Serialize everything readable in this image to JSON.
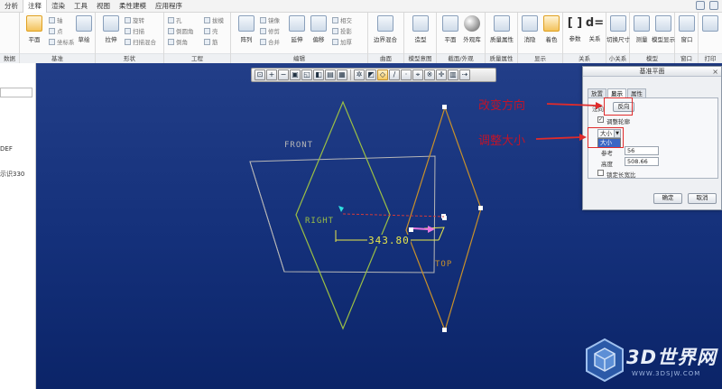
{
  "menubar": {
    "items": [
      "分析",
      "注释",
      "渲染",
      "工具",
      "视图",
      "柔性建模",
      "应用程序"
    ],
    "active_index": 1
  },
  "ribbon": {
    "groups": [
      {
        "label": "数据"
      },
      {
        "label": "基准"
      },
      {
        "label": "形状"
      },
      {
        "label": "工程"
      },
      {
        "label": "编辑"
      },
      {
        "label": "曲面"
      },
      {
        "label": "模型意图"
      },
      {
        "label": "截面/外观"
      },
      {
        "label": "质量属性"
      },
      {
        "label": "显示"
      },
      {
        "label": "关系"
      },
      {
        "label": "小关系"
      },
      {
        "label": "模型"
      },
      {
        "label": "窗口"
      },
      {
        "label": "打印"
      }
    ],
    "buttons": {
      "plane": "平面",
      "axis": "轴",
      "point": "点",
      "csys": "坐标系",
      "sketch": "草绘",
      "extrude": "拉伸",
      "revolve": "旋转",
      "sweep": "扫描",
      "swept_blend": "扫描混合",
      "hole": "孔",
      "round": "倒圆角",
      "chamfer": "倒角",
      "shell": "壳",
      "draft": "拔模",
      "rib": "筋",
      "pattern": "阵列",
      "mirror": "镜像",
      "trim": "修剪",
      "merge": "合并",
      "extend": "延伸",
      "offset": "偏移",
      "intersect": "相交",
      "project": "投影",
      "thicken": "加厚",
      "solidify": "实体化",
      "boundary_blend": "边界混合",
      "style": "造型",
      "freestyle": "自由式",
      "plane_view": "平面",
      "appearance": "外观库",
      "mass_props": "质量属性",
      "hidden": "消隐",
      "shaded": "着色",
      "params": "参数",
      "relations": "关系",
      "switch_size": "切换尺寸",
      "measure": "测量",
      "model_tree": "模型显示",
      "window": "窗口"
    }
  },
  "tree": {
    "texts": [
      "DEF",
      "示识330"
    ]
  },
  "viewport": {
    "plane_labels": {
      "front": "FRONT",
      "right": "RIGHT",
      "top": "TOP"
    },
    "dimension": "343.80",
    "toolbar_icons": [
      "zoom-fit",
      "zoom-in",
      "zoom-out",
      "refit",
      "repaint",
      "shading",
      "display-style",
      "saved-views",
      "datum-plane-display",
      "axis-display",
      "point-display",
      "csys-display",
      "annotation-display",
      "spin-center"
    ]
  },
  "dialog": {
    "title": "基准平面",
    "tabs": [
      "放置",
      "显示",
      "属性"
    ],
    "active_tab": 1,
    "normal_label": "法向",
    "flip_button": "反向",
    "adjust_outline_label": "调整轮廓",
    "adjust_outline_checked": true,
    "size_select": "大小",
    "size_option": "大小",
    "ref_label": "参考",
    "ref_value": "56",
    "height_label": "高度",
    "height_value": "508.66",
    "lock_ratio_label": "锁定长宽比",
    "lock_ratio_checked": false,
    "ok_label": "确定",
    "cancel_label": "取消"
  },
  "annotations": {
    "flip_direction": "改变方向",
    "adjust_size": "调整大小"
  },
  "watermark": {
    "text": "3D世界网",
    "url": "WWW.3DSJW.COM"
  },
  "colors": {
    "viewport_bg": "#1a3680",
    "annotation": "#c0142a",
    "plane_green": "#8fb23a",
    "plane_orange": "#c8902a",
    "plane_gray": "#b8b8b8",
    "dimension_yellow": "#e9e84a",
    "arrow_pink": "#e877e0"
  }
}
